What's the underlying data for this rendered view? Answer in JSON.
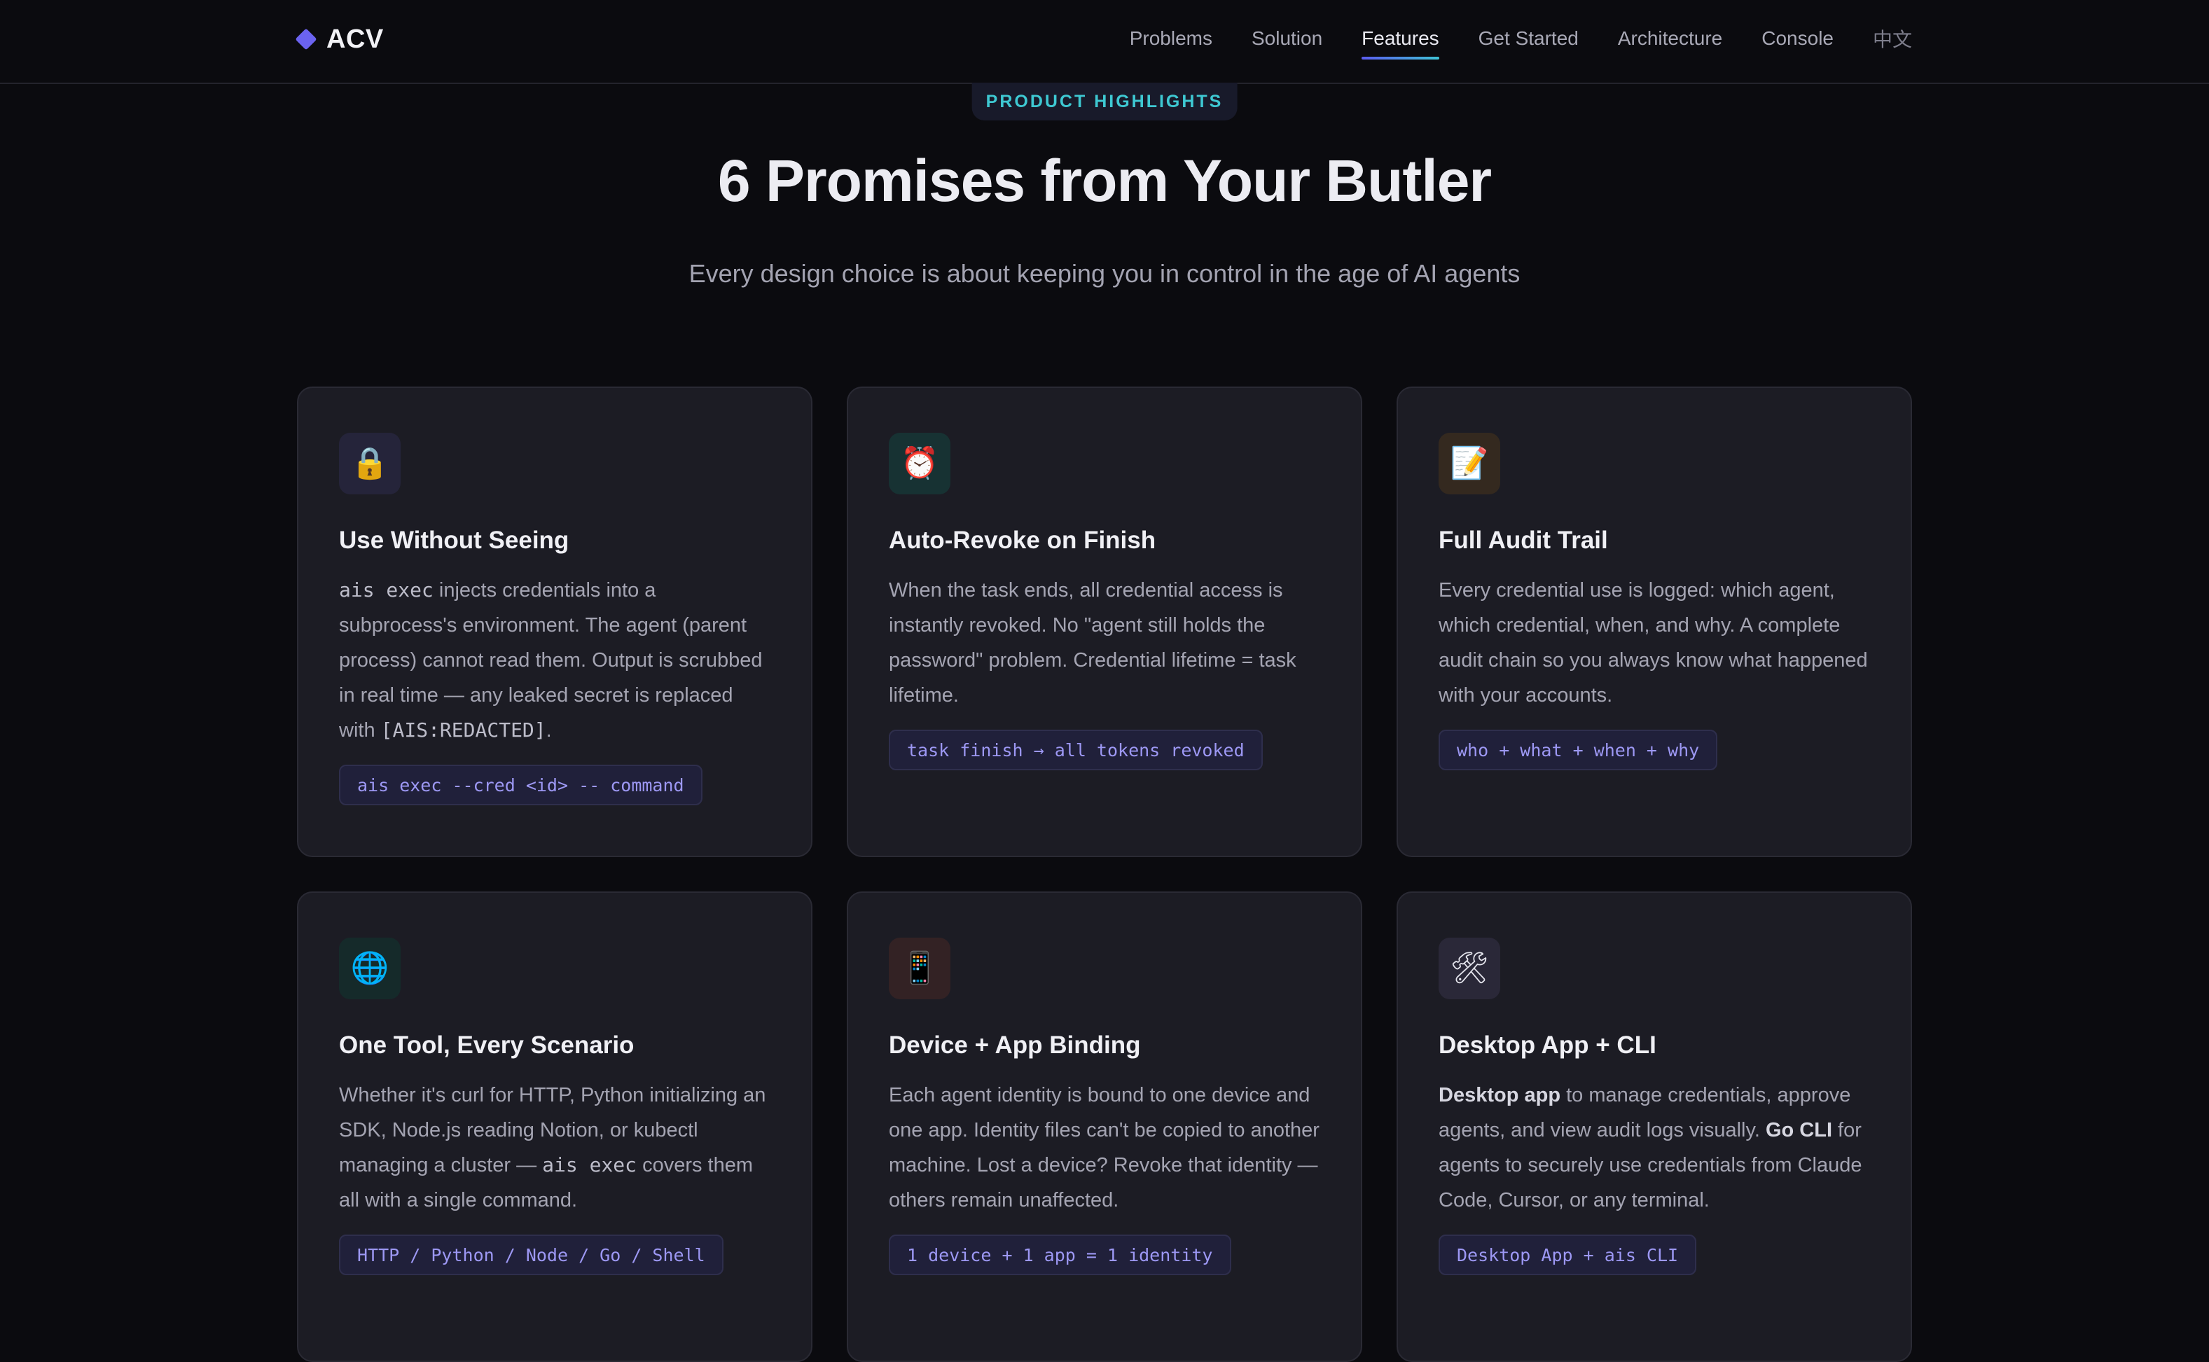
{
  "nav": {
    "brand": "ACV",
    "links": [
      {
        "label": "Problems",
        "active": false
      },
      {
        "label": "Solution",
        "active": false
      },
      {
        "label": "Features",
        "active": true
      },
      {
        "label": "Get Started",
        "active": false
      },
      {
        "label": "Architecture",
        "active": false
      },
      {
        "label": "Console",
        "active": false
      },
      {
        "label": "中文",
        "active": false
      }
    ]
  },
  "hero": {
    "badge": "PRODUCT HIGHLIGHTS",
    "title": "6 Promises from Your Butler",
    "subtitle": "Every design choice is about keeping you in control in the age of AI agents"
  },
  "cards": [
    {
      "icon": "lock-icon",
      "icon_glyph": "🔒",
      "icon_bg": "#25243a",
      "title": "Use Without Seeing",
      "desc": [
        {
          "t": "code",
          "v": "ais exec"
        },
        {
          "t": "text",
          "v": " injects credentials into a subprocess's environment. The agent (parent process) cannot read them. Output is scrubbed in real time — any leaked secret is replaced with "
        },
        {
          "t": "code",
          "v": "[AIS:REDACTED]"
        },
        {
          "t": "text",
          "v": "."
        }
      ],
      "tag": "ais exec --cred <id> -- command"
    },
    {
      "icon": "alarm-clock-icon",
      "icon_glyph": "⏰",
      "icon_bg": "#173233",
      "title": "Auto-Revoke on Finish",
      "desc": [
        {
          "t": "text",
          "v": "When the task ends, all credential access is instantly revoked. No \"agent still holds the password\" problem. Credential lifetime = task lifetime."
        }
      ],
      "tag": "task finish → all tokens revoked"
    },
    {
      "icon": "memo-icon",
      "icon_glyph": "📝",
      "icon_bg": "#34291f",
      "title": "Full Audit Trail",
      "desc": [
        {
          "t": "text",
          "v": "Every credential use is logged: which agent, which credential, when, and why. A complete audit chain so you always know what happened with your accounts."
        }
      ],
      "tag": "who + what + when + why"
    },
    {
      "icon": "globe-icon",
      "icon_glyph": "🌐",
      "icon_bg": "#152a2a",
      "title": "One Tool, Every Scenario",
      "desc": [
        {
          "t": "text",
          "v": "Whether it's curl for HTTP, Python initializing an SDK, Node.js reading Notion, or kubectl managing a cluster — "
        },
        {
          "t": "code",
          "v": "ais exec"
        },
        {
          "t": "text",
          "v": " covers them all with a single command."
        }
      ],
      "tag": "HTTP / Python / Node / Go / Shell"
    },
    {
      "icon": "mobile-phone-icon",
      "icon_glyph": "📱",
      "icon_bg": "#332224",
      "title": "Device + App Binding",
      "desc": [
        {
          "t": "text",
          "v": "Each agent identity is bound to one device and one app. Identity files can't be copied to another machine. Lost a device? Revoke that identity — others remain unaffected."
        }
      ],
      "tag": "1 device + 1 app = 1 identity"
    },
    {
      "icon": "hammer-wrench-icon",
      "icon_glyph": "🛠",
      "icon_bg": "#2a2838",
      "title": "Desktop App + CLI",
      "desc": [
        {
          "t": "strong",
          "v": "Desktop app"
        },
        {
          "t": "text",
          "v": " to manage credentials, approve agents, and view audit logs visually. "
        },
        {
          "t": "strong",
          "v": "Go CLI"
        },
        {
          "t": "text",
          "v": " for agents to securely use credentials from Claude Code, Cursor, or any terminal."
        }
      ],
      "tag": "Desktop App + ais CLI"
    }
  ]
}
